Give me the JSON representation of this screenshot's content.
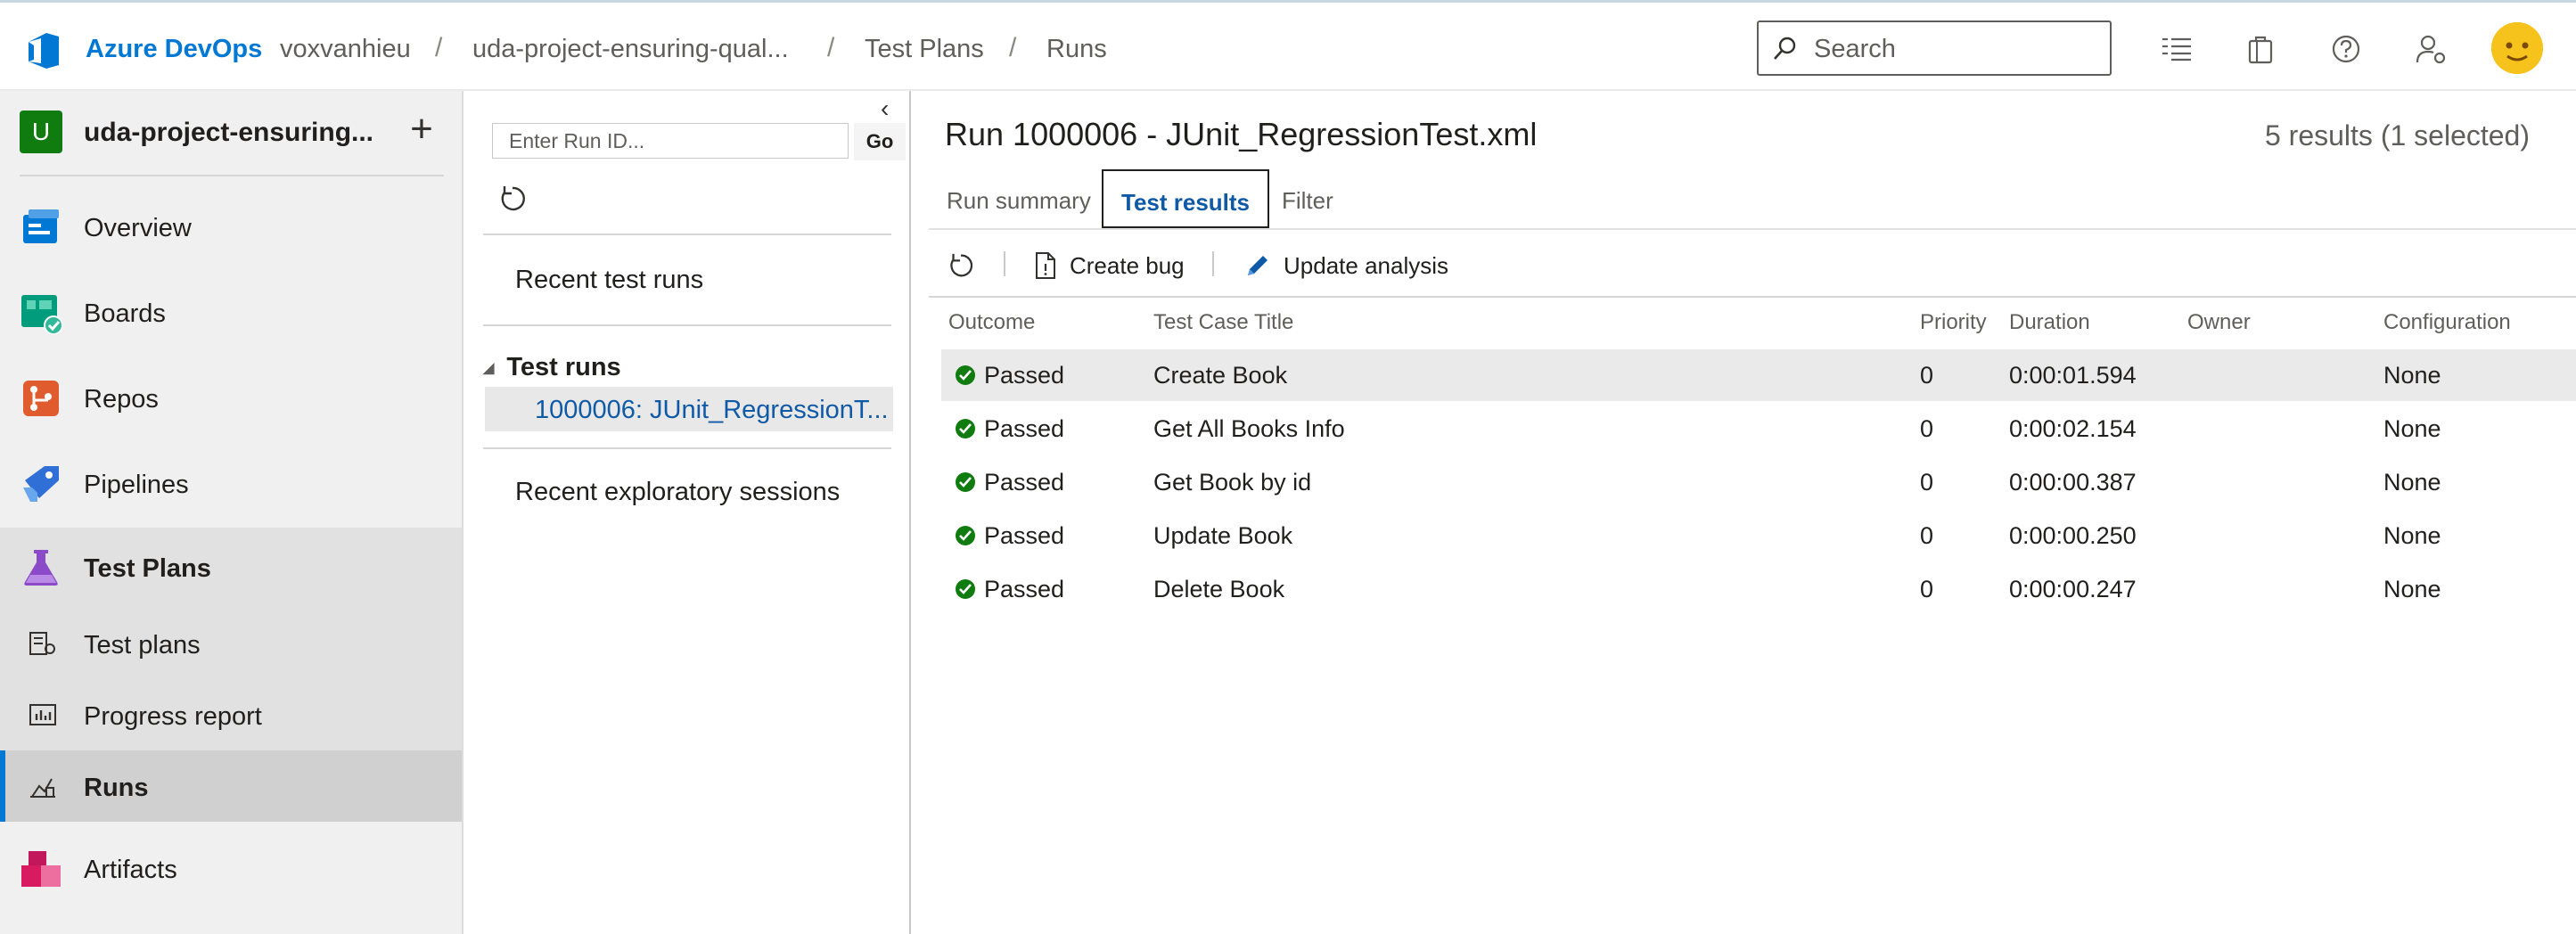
{
  "topbar": {
    "brand": "Azure DevOps",
    "org": "voxvanhieu",
    "project": "uda-project-ensuring-qual...",
    "section": "Test Plans",
    "page": "Runs",
    "separator": "/",
    "search_placeholder": "Search",
    "icons": [
      "work-items-icon",
      "marketplace-bag-icon",
      "help-icon",
      "user-settings-icon",
      "avatar"
    ]
  },
  "sidebar": {
    "project_initial": "U",
    "project_name": "uda-project-ensuring...",
    "add_label": "+",
    "items": [
      {
        "label": "Overview",
        "icon": "overview-icon",
        "color": "#0078d4"
      },
      {
        "label": "Boards",
        "icon": "boards-icon",
        "color": "#009c7b"
      },
      {
        "label": "Repos",
        "icon": "repos-icon",
        "color": "#e05c2f"
      },
      {
        "label": "Pipelines",
        "icon": "pipelines-icon",
        "color": "#2f6fd6"
      },
      {
        "label": "Test Plans",
        "icon": "test-plans-icon",
        "color": "#8b4bc9"
      },
      {
        "label": "Artifacts",
        "icon": "artifacts-icon",
        "color": "#c2185b"
      }
    ],
    "sub_items": [
      {
        "label": "Test plans",
        "icon": "test-plans-list-icon"
      },
      {
        "label": "Progress report",
        "icon": "progress-report-icon"
      },
      {
        "label": "Runs",
        "icon": "runs-icon",
        "active": true
      }
    ]
  },
  "runs_pane": {
    "run_id_placeholder": "Enter Run ID...",
    "go_label": "Go",
    "recent_runs_label": "Recent test runs",
    "test_runs_label": "Test runs",
    "selected_run": "1000006: JUnit_RegressionT...",
    "recent_exploratory_label": "Recent exploratory sessions"
  },
  "main": {
    "title": "Run 1000006 - JUnit_RegressionTest.xml",
    "result_count": "5 results (1 selected)",
    "tabs": [
      {
        "label": "Run summary",
        "active": false
      },
      {
        "label": "Test results",
        "active": true
      },
      {
        "label": "Filter",
        "active": false
      }
    ],
    "toolbar": {
      "create_bug": "Create bug",
      "update_analysis": "Update analysis"
    },
    "columns": [
      "Outcome",
      "Test Case Title",
      "Priority",
      "Duration",
      "Owner",
      "Configuration"
    ],
    "rows": [
      {
        "outcome": "Passed",
        "title": "Create Book",
        "priority": "0",
        "duration": "0:00:01.594",
        "owner": "",
        "configuration": "None",
        "selected": true
      },
      {
        "outcome": "Passed",
        "title": "Get All Books Info",
        "priority": "0",
        "duration": "0:00:02.154",
        "owner": "",
        "configuration": "None",
        "selected": false
      },
      {
        "outcome": "Passed",
        "title": "Get Book by id",
        "priority": "0",
        "duration": "0:00:00.387",
        "owner": "",
        "configuration": "None",
        "selected": false
      },
      {
        "outcome": "Passed",
        "title": "Update Book",
        "priority": "0",
        "duration": "0:00:00.250",
        "owner": "",
        "configuration": "None",
        "selected": false
      },
      {
        "outcome": "Passed",
        "title": "Delete Book",
        "priority": "0",
        "duration": "0:00:00.247",
        "owner": "",
        "configuration": "None",
        "selected": false
      }
    ]
  },
  "colors": {
    "accent": "#0078d4",
    "link": "#0f5aa6",
    "passed": "#107c10",
    "nav_bg": "#f0f0f0",
    "nav_active": "#d0d0d0"
  }
}
